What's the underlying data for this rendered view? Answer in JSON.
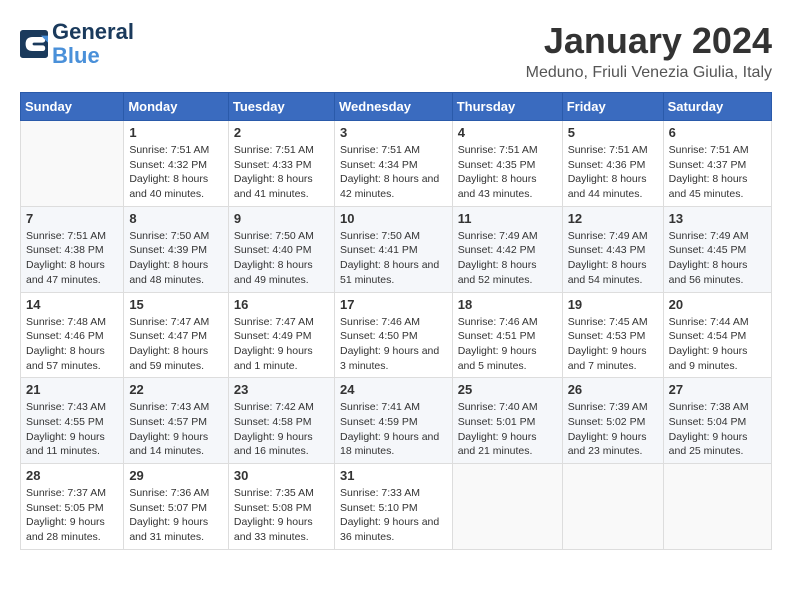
{
  "logo": {
    "line1": "General",
    "line2": "Blue"
  },
  "title": "January 2024",
  "subtitle": "Meduno, Friuli Venezia Giulia, Italy",
  "weekdays": [
    "Sunday",
    "Monday",
    "Tuesday",
    "Wednesday",
    "Thursday",
    "Friday",
    "Saturday"
  ],
  "weeks": [
    [
      {
        "day": "",
        "sunrise": "",
        "sunset": "",
        "daylight": ""
      },
      {
        "day": "1",
        "sunrise": "Sunrise: 7:51 AM",
        "sunset": "Sunset: 4:32 PM",
        "daylight": "Daylight: 8 hours and 40 minutes."
      },
      {
        "day": "2",
        "sunrise": "Sunrise: 7:51 AM",
        "sunset": "Sunset: 4:33 PM",
        "daylight": "Daylight: 8 hours and 41 minutes."
      },
      {
        "day": "3",
        "sunrise": "Sunrise: 7:51 AM",
        "sunset": "Sunset: 4:34 PM",
        "daylight": "Daylight: 8 hours and 42 minutes."
      },
      {
        "day": "4",
        "sunrise": "Sunrise: 7:51 AM",
        "sunset": "Sunset: 4:35 PM",
        "daylight": "Daylight: 8 hours and 43 minutes."
      },
      {
        "day": "5",
        "sunrise": "Sunrise: 7:51 AM",
        "sunset": "Sunset: 4:36 PM",
        "daylight": "Daylight: 8 hours and 44 minutes."
      },
      {
        "day": "6",
        "sunrise": "Sunrise: 7:51 AM",
        "sunset": "Sunset: 4:37 PM",
        "daylight": "Daylight: 8 hours and 45 minutes."
      }
    ],
    [
      {
        "day": "7",
        "sunrise": "Sunrise: 7:51 AM",
        "sunset": "Sunset: 4:38 PM",
        "daylight": "Daylight: 8 hours and 47 minutes."
      },
      {
        "day": "8",
        "sunrise": "Sunrise: 7:50 AM",
        "sunset": "Sunset: 4:39 PM",
        "daylight": "Daylight: 8 hours and 48 minutes."
      },
      {
        "day": "9",
        "sunrise": "Sunrise: 7:50 AM",
        "sunset": "Sunset: 4:40 PM",
        "daylight": "Daylight: 8 hours and 49 minutes."
      },
      {
        "day": "10",
        "sunrise": "Sunrise: 7:50 AM",
        "sunset": "Sunset: 4:41 PM",
        "daylight": "Daylight: 8 hours and 51 minutes."
      },
      {
        "day": "11",
        "sunrise": "Sunrise: 7:49 AM",
        "sunset": "Sunset: 4:42 PM",
        "daylight": "Daylight: 8 hours and 52 minutes."
      },
      {
        "day": "12",
        "sunrise": "Sunrise: 7:49 AM",
        "sunset": "Sunset: 4:43 PM",
        "daylight": "Daylight: 8 hours and 54 minutes."
      },
      {
        "day": "13",
        "sunrise": "Sunrise: 7:49 AM",
        "sunset": "Sunset: 4:45 PM",
        "daylight": "Daylight: 8 hours and 56 minutes."
      }
    ],
    [
      {
        "day": "14",
        "sunrise": "Sunrise: 7:48 AM",
        "sunset": "Sunset: 4:46 PM",
        "daylight": "Daylight: 8 hours and 57 minutes."
      },
      {
        "day": "15",
        "sunrise": "Sunrise: 7:47 AM",
        "sunset": "Sunset: 4:47 PM",
        "daylight": "Daylight: 8 hours and 59 minutes."
      },
      {
        "day": "16",
        "sunrise": "Sunrise: 7:47 AM",
        "sunset": "Sunset: 4:49 PM",
        "daylight": "Daylight: 9 hours and 1 minute."
      },
      {
        "day": "17",
        "sunrise": "Sunrise: 7:46 AM",
        "sunset": "Sunset: 4:50 PM",
        "daylight": "Daylight: 9 hours and 3 minutes."
      },
      {
        "day": "18",
        "sunrise": "Sunrise: 7:46 AM",
        "sunset": "Sunset: 4:51 PM",
        "daylight": "Daylight: 9 hours and 5 minutes."
      },
      {
        "day": "19",
        "sunrise": "Sunrise: 7:45 AM",
        "sunset": "Sunset: 4:53 PM",
        "daylight": "Daylight: 9 hours and 7 minutes."
      },
      {
        "day": "20",
        "sunrise": "Sunrise: 7:44 AM",
        "sunset": "Sunset: 4:54 PM",
        "daylight": "Daylight: 9 hours and 9 minutes."
      }
    ],
    [
      {
        "day": "21",
        "sunrise": "Sunrise: 7:43 AM",
        "sunset": "Sunset: 4:55 PM",
        "daylight": "Daylight: 9 hours and 11 minutes."
      },
      {
        "day": "22",
        "sunrise": "Sunrise: 7:43 AM",
        "sunset": "Sunset: 4:57 PM",
        "daylight": "Daylight: 9 hours and 14 minutes."
      },
      {
        "day": "23",
        "sunrise": "Sunrise: 7:42 AM",
        "sunset": "Sunset: 4:58 PM",
        "daylight": "Daylight: 9 hours and 16 minutes."
      },
      {
        "day": "24",
        "sunrise": "Sunrise: 7:41 AM",
        "sunset": "Sunset: 4:59 PM",
        "daylight": "Daylight: 9 hours and 18 minutes."
      },
      {
        "day": "25",
        "sunrise": "Sunrise: 7:40 AM",
        "sunset": "Sunset: 5:01 PM",
        "daylight": "Daylight: 9 hours and 21 minutes."
      },
      {
        "day": "26",
        "sunrise": "Sunrise: 7:39 AM",
        "sunset": "Sunset: 5:02 PM",
        "daylight": "Daylight: 9 hours and 23 minutes."
      },
      {
        "day": "27",
        "sunrise": "Sunrise: 7:38 AM",
        "sunset": "Sunset: 5:04 PM",
        "daylight": "Daylight: 9 hours and 25 minutes."
      }
    ],
    [
      {
        "day": "28",
        "sunrise": "Sunrise: 7:37 AM",
        "sunset": "Sunset: 5:05 PM",
        "daylight": "Daylight: 9 hours and 28 minutes."
      },
      {
        "day": "29",
        "sunrise": "Sunrise: 7:36 AM",
        "sunset": "Sunset: 5:07 PM",
        "daylight": "Daylight: 9 hours and 31 minutes."
      },
      {
        "day": "30",
        "sunrise": "Sunrise: 7:35 AM",
        "sunset": "Sunset: 5:08 PM",
        "daylight": "Daylight: 9 hours and 33 minutes."
      },
      {
        "day": "31",
        "sunrise": "Sunrise: 7:33 AM",
        "sunset": "Sunset: 5:10 PM",
        "daylight": "Daylight: 9 hours and 36 minutes."
      },
      {
        "day": "",
        "sunrise": "",
        "sunset": "",
        "daylight": ""
      },
      {
        "day": "",
        "sunrise": "",
        "sunset": "",
        "daylight": ""
      },
      {
        "day": "",
        "sunrise": "",
        "sunset": "",
        "daylight": ""
      }
    ]
  ]
}
